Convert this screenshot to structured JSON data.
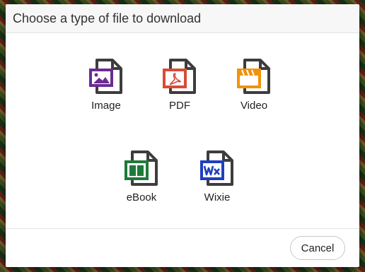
{
  "dialog": {
    "title": "Choose a type of file to download",
    "cancel_label": "Cancel"
  },
  "file_types": [
    {
      "label": "Image",
      "icon": "image-file-icon",
      "color": "#6a2c91"
    },
    {
      "label": "PDF",
      "icon": "pdf-file-icon",
      "color": "#d94b36"
    },
    {
      "label": "Video",
      "icon": "video-file-icon",
      "color": "#f2920c"
    },
    {
      "label": "eBook",
      "icon": "ebook-file-icon",
      "color": "#1e7a3a"
    },
    {
      "label": "Wixie",
      "icon": "wixie-file-icon",
      "color": "#1f3fbf"
    }
  ],
  "colors": {
    "doc_outline": "#3d3d3d"
  }
}
